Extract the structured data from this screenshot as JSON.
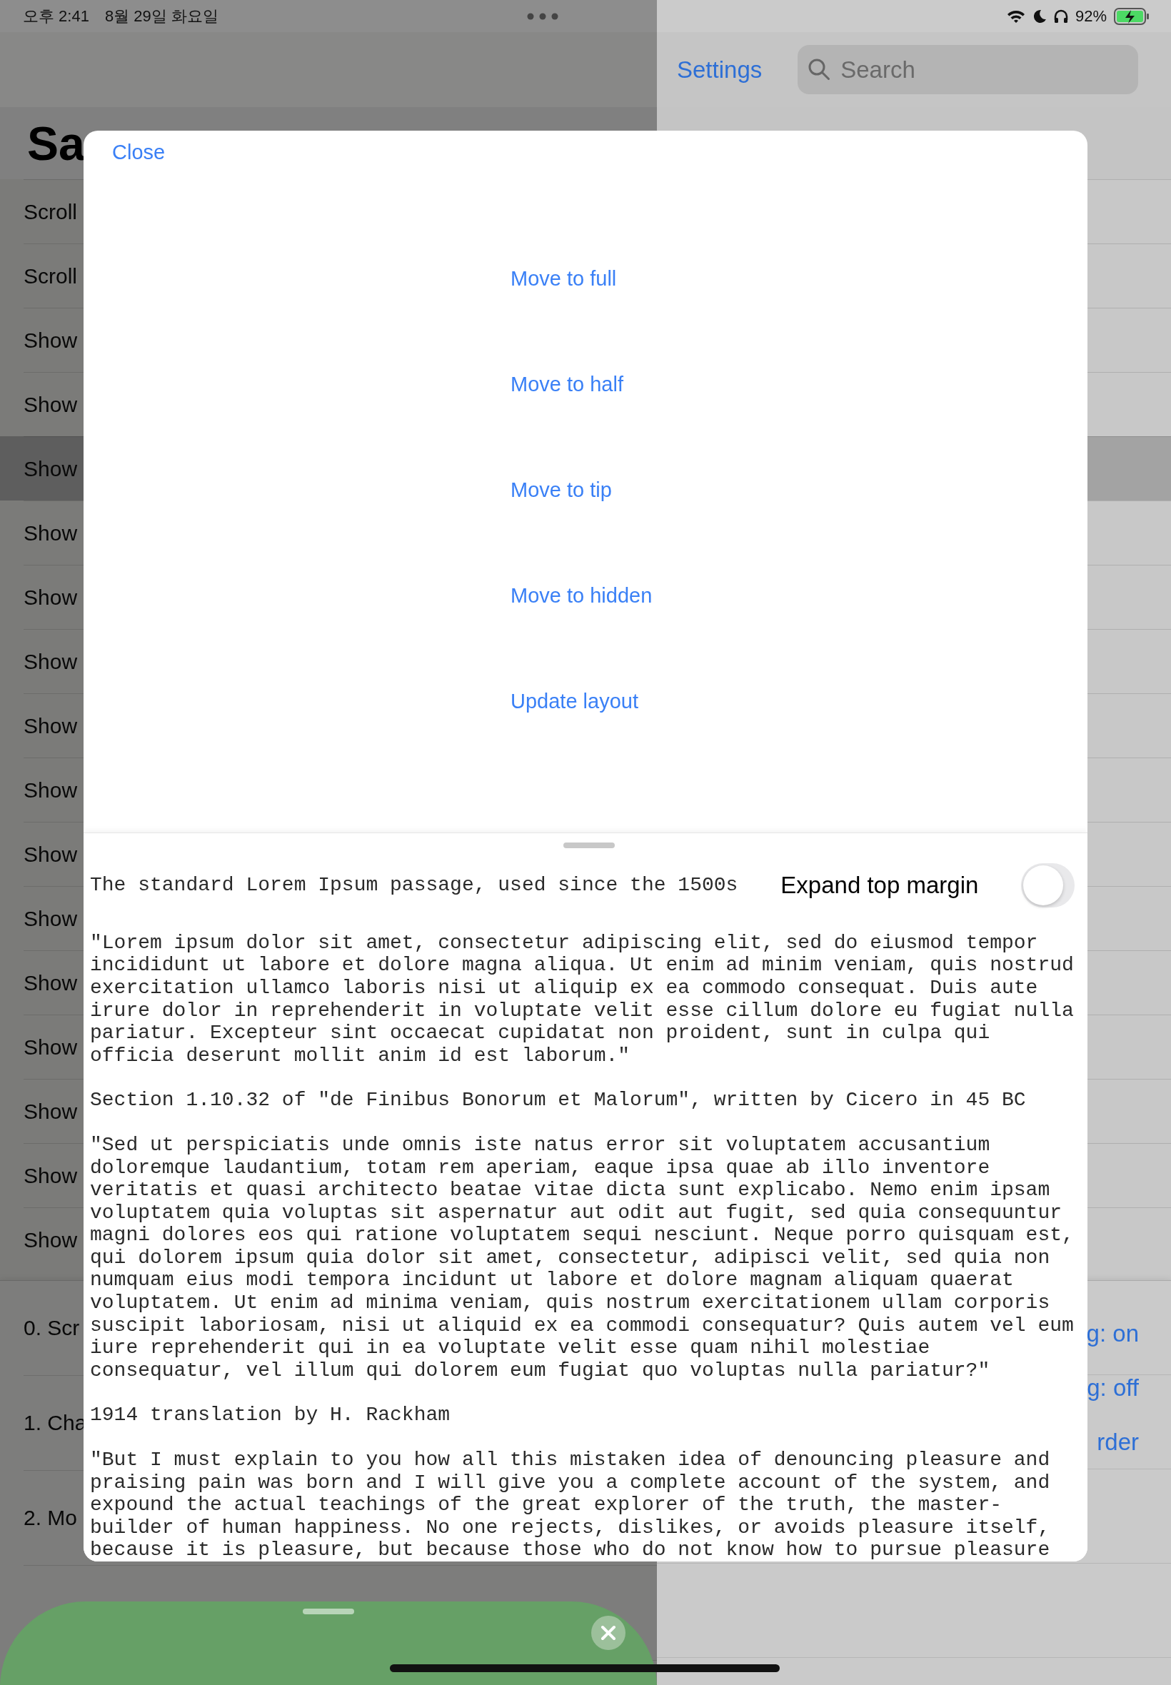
{
  "status_bar": {
    "time": "오후 2:41",
    "date": "8월 29일 화요일",
    "battery": "92%"
  },
  "nav": {
    "settings": "Settings",
    "search": {
      "placeholder": "Search"
    }
  },
  "title": "Sa",
  "list": [
    {
      "label": "Scroll",
      "selected": false
    },
    {
      "label": "Scroll",
      "selected": false
    },
    {
      "label": "Show",
      "selected": false
    },
    {
      "label": "Show",
      "selected": false
    },
    {
      "label": "Show",
      "selected": true
    },
    {
      "label": "Show",
      "selected": false
    },
    {
      "label": "Show",
      "selected": false
    },
    {
      "label": "Show",
      "selected": false
    },
    {
      "label": "Show",
      "selected": false
    },
    {
      "label": "Show",
      "selected": false
    },
    {
      "label": "Show",
      "selected": false
    },
    {
      "label": "Show",
      "selected": false
    },
    {
      "label": "Show",
      "selected": false
    },
    {
      "label": "Show",
      "selected": false
    },
    {
      "label": "Show",
      "selected": false
    },
    {
      "label": "Show",
      "selected": false
    },
    {
      "label": "Show",
      "selected": false
    }
  ],
  "lower_list": {
    "left": [
      "0. Scr",
      "1. Cha",
      "2. Mo"
    ],
    "right": [
      "g: on",
      "g: off",
      "rder"
    ]
  },
  "modal": {
    "close": "Close",
    "actions": [
      "Move to full",
      "Move to half",
      "Move to tip",
      "Move to hidden",
      "Update layout"
    ],
    "panel": {
      "header": "The standard Lorem Ipsum passage, used since the 1500s",
      "toggle": {
        "label": "Expand top margin",
        "on": false
      },
      "blocks": [
        "\"Lorem ipsum dolor sit amet, consectetur adipiscing elit, sed do eiusmod tempor incididunt ut labore et dolore magna aliqua. Ut enim ad minim veniam, quis nostrud exercitation ullamco laboris nisi ut aliquip ex ea commodo consequat. Duis aute irure dolor in reprehenderit in voluptate velit esse cillum dolore eu fugiat nulla pariatur. Excepteur sint occaecat cupidatat non proident, sunt in culpa qui officia deserunt mollit anim id est laborum.\"",
        "Section 1.10.32 of \"de Finibus Bonorum et Malorum\", written by Cicero in 45 BC",
        "\"Sed ut perspiciatis unde omnis iste natus error sit voluptatem accusantium doloremque laudantium, totam rem aperiam, eaque ipsa quae ab illo inventore veritatis et quasi architecto beatae vitae dicta sunt explicabo. Nemo enim ipsam voluptatem quia voluptas sit aspernatur aut odit aut fugit, sed quia consequuntur magni dolores eos qui ratione voluptatem sequi nesciunt. Neque porro quisquam est, qui dolorem ipsum quia dolor sit amet, consectetur, adipisci velit, sed quia non numquam eius modi tempora incidunt ut labore et dolore magnam aliquam quaerat voluptatem. Ut enim ad minima veniam, quis nostrum exercitationem ullam corporis suscipit laboriosam, nisi ut aliquid ex ea commodi consequatur? Quis autem vel eum iure reprehenderit qui in ea voluptate velit esse quam nihil molestiae consequatur, vel illum qui dolorem eum fugiat quo voluptas nulla pariatur?\"",
        "1914 translation by H. Rackham",
        "\"But I must explain to you how all this mistaken idea of denouncing pleasure and praising pain was born and I will give you a complete account of the system, and expound the actual teachings of the great explorer of the truth, the master-builder of human happiness. No one rejects, dislikes, or avoids pleasure itself, because it is pleasure, but because those who do not know how to pursue pleasure"
      ]
    }
  }
}
